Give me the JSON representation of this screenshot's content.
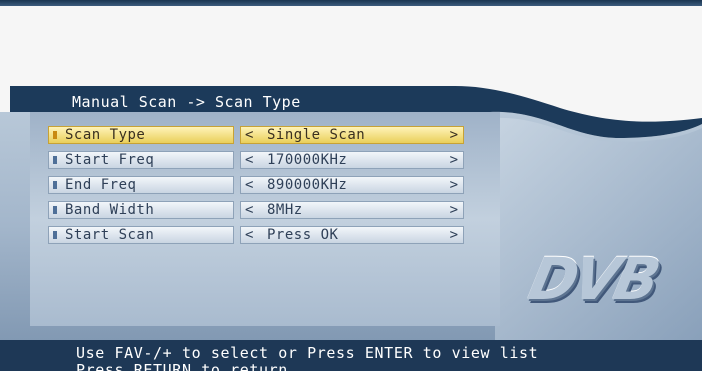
{
  "panel": {
    "title": "Manual Scan -> Scan Type"
  },
  "menu": {
    "selected_index": 0,
    "rows": [
      {
        "label": "Scan Type",
        "value": "Single Scan"
      },
      {
        "label": "Start Freq",
        "value": "170000KHz"
      },
      {
        "label": "End Freq",
        "value": "890000KHz"
      },
      {
        "label": "Band Width",
        "value": "8MHz"
      },
      {
        "label": "Start Scan",
        "value": "Press OK"
      }
    ],
    "arrow_left": "<",
    "arrow_right": ">"
  },
  "logo": {
    "text": "DVB"
  },
  "footer": {
    "line1": "Use FAV-/+ to select or Press ENTER to view list",
    "line2": "Press RETURN to return"
  },
  "colors": {
    "header_bar": "#1c3a5a",
    "selected_row": "#e9cf5a",
    "footer_bar": "#1e3856"
  }
}
